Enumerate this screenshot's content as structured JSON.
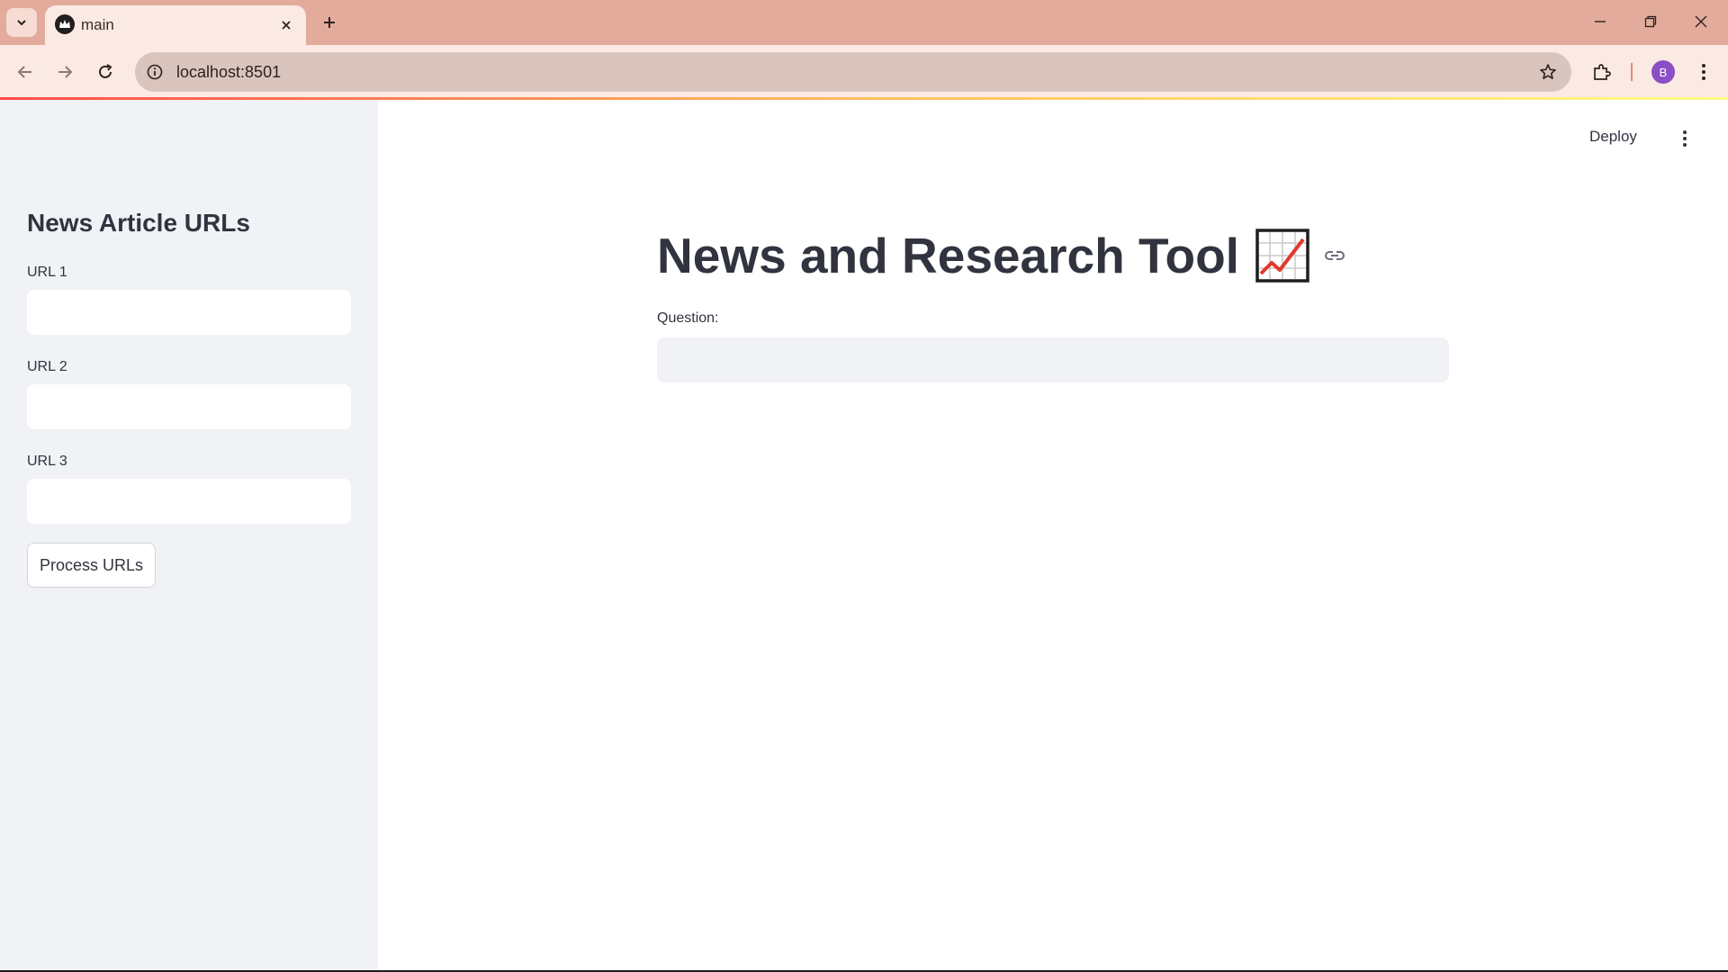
{
  "browser": {
    "tab_title": "main",
    "url": "localhost:8501",
    "profile_initial": "B",
    "icons": [
      "tab-search-icon",
      "favicon-icon",
      "close-icon",
      "plus-icon",
      "minimize-icon",
      "restore-icon",
      "window-close-icon",
      "back-icon",
      "forward-icon",
      "reload-icon",
      "site-info-icon",
      "star-icon",
      "extensions-icon",
      "kebab-menu-icon"
    ]
  },
  "sidebar": {
    "title": "News Article URLs",
    "fields": [
      {
        "label": "URL 1",
        "value": ""
      },
      {
        "label": "URL 2",
        "value": ""
      },
      {
        "label": "URL 3",
        "value": ""
      }
    ],
    "process_button": "Process URLs"
  },
  "header": {
    "deploy_label": "Deploy"
  },
  "main": {
    "title": "News and Research Tool",
    "title_emoji_icon": "chart-increasing-icon",
    "question_label": "Question:",
    "question_value": ""
  },
  "colors": {
    "tabbar": "#e3ab9b",
    "toolbar": "#fbe9e3",
    "sidebar": "#f0f2f6",
    "text": "#31333f",
    "accent": "#ff4b4b"
  }
}
